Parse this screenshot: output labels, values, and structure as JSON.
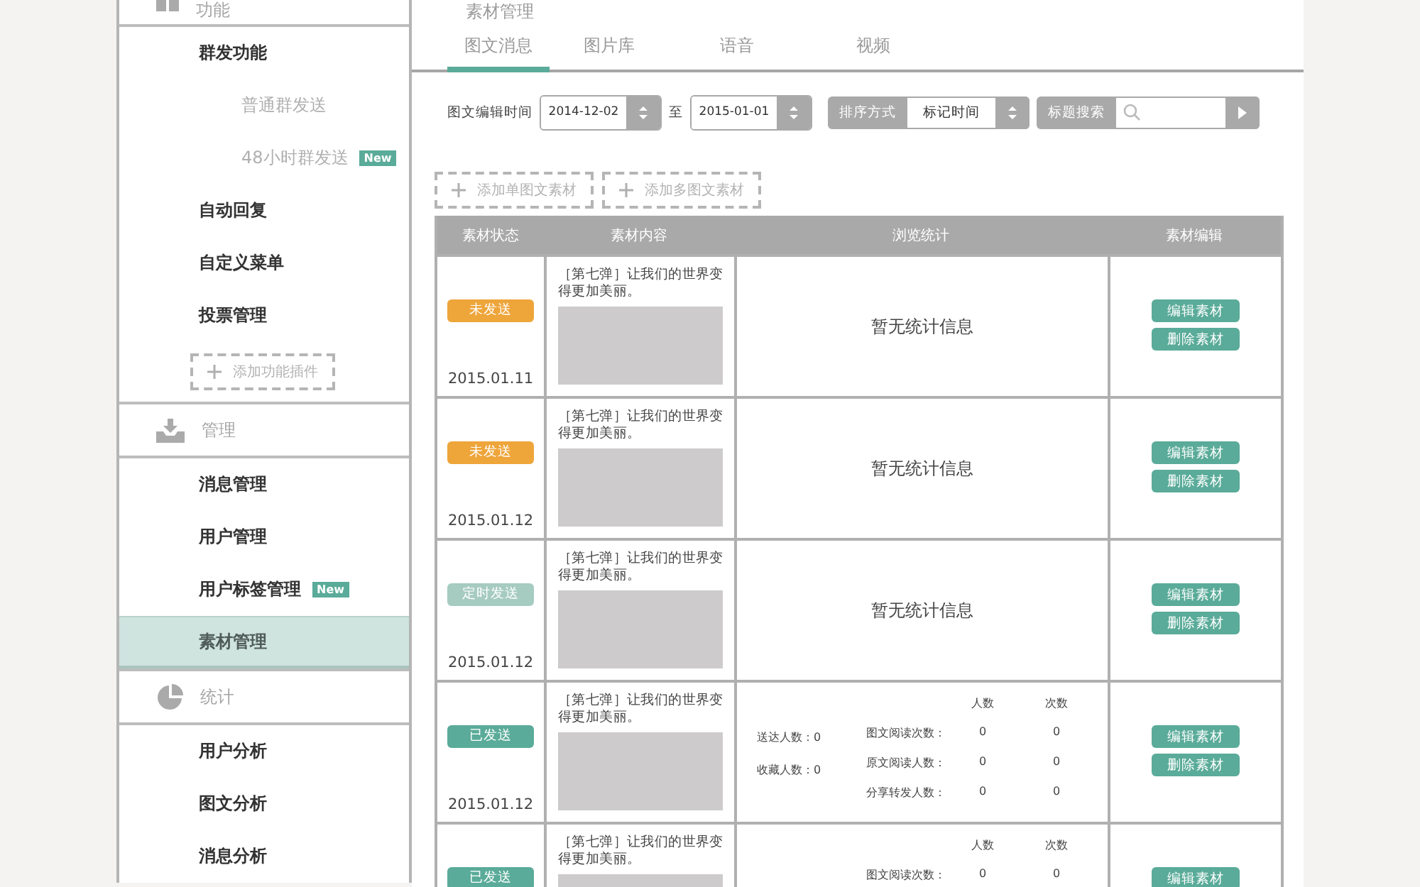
{
  "sidebar": {
    "sections": [
      {
        "title": "功能",
        "items": [
          {
            "label": "群发功能",
            "selected": false,
            "children": [
              {
                "label": "普通群发送",
                "selected": false
              },
              {
                "label": "48小时群发送",
                "badge": "New",
                "selected": false
              }
            ]
          },
          {
            "label": "自动回复",
            "selected": false
          },
          {
            "label": "自定义菜单",
            "selected": false
          },
          {
            "label": "投票管理",
            "selected": false
          }
        ],
        "add_button": "添加功能插件"
      },
      {
        "title": "管理",
        "items": [
          {
            "label": "消息管理",
            "selected": false
          },
          {
            "label": "用户管理",
            "selected": false
          },
          {
            "label": "用户标签管理",
            "badge": "New",
            "selected": false
          },
          {
            "label": "素材管理",
            "selected": true
          }
        ]
      },
      {
        "title": "统计",
        "items": [
          {
            "label": "用户分析",
            "selected": false
          },
          {
            "label": "图文分析",
            "selected": false
          },
          {
            "label": "消息分析",
            "selected": false
          }
        ]
      }
    ]
  },
  "main": {
    "breadcrumb": "素材管理",
    "tabs": [
      {
        "label": "图文消息",
        "selected": true
      },
      {
        "label": "图片库",
        "selected": false
      },
      {
        "label": "语音",
        "selected": false
      },
      {
        "label": "视频",
        "selected": false
      }
    ],
    "filters": {
      "date_label": "图文编辑时间",
      "from": "2014-12-02",
      "separator": "至",
      "to": "2015-01-01",
      "sort_label": "排序方式",
      "sort_value": "标记时间",
      "search_label": "标题搜索"
    },
    "add_buttons": [
      "添加单图文素材",
      "添加多图文素材"
    ],
    "table": {
      "columns": [
        "素材状态",
        "素材内容",
        "浏览统计",
        "素材编辑"
      ],
      "rows": [
        {
          "status": {
            "label": "未发送",
            "kind": "unsent"
          },
          "date": "2015.01.11",
          "title": "［第七弹］让我们的世界变得更加美丽。",
          "stats": {
            "kind": "empty",
            "text": "暂无统计信息"
          },
          "actions": [
            "编辑素材",
            "删除素材"
          ]
        },
        {
          "status": {
            "label": "未发送",
            "kind": "unsent"
          },
          "date": "2015.01.12",
          "title": "［第七弹］让我们的世界变得更加美丽。",
          "stats": {
            "kind": "empty",
            "text": "暂无统计信息"
          },
          "actions": [
            "编辑素材",
            "删除素材"
          ]
        },
        {
          "status": {
            "label": "定时发送",
            "kind": "scheduled"
          },
          "date": "2015.01.12",
          "title": "［第七弹］让我们的世界变得更加美丽。",
          "stats": {
            "kind": "empty",
            "text": "暂无统计信息"
          },
          "actions": [
            "编辑素材",
            "删除素材"
          ]
        },
        {
          "status": {
            "label": "已发送",
            "kind": "sent"
          },
          "date": "2015.01.12",
          "title": "［第七弹］让我们的世界变得更加美丽。",
          "stats": {
            "kind": "detail",
            "summary": [
              "送达人数：0",
              "收藏人数：0"
            ],
            "headers": [
              "人数",
              "次数"
            ],
            "lines": [
              {
                "label": "图文阅读次数：",
                "values": [
                  "0",
                  "0"
                ]
              },
              {
                "label": "原文阅读人数：",
                "values": [
                  "0",
                  "0"
                ]
              },
              {
                "label": "分享转发人数：",
                "values": [
                  "0",
                  "0"
                ]
              }
            ]
          },
          "actions": [
            "编辑素材",
            "删除素材"
          ]
        },
        {
          "status": {
            "label": "已发送",
            "kind": "sent"
          },
          "title": "［第七弹］让我们的世界变得更加美丽。",
          "stats": {
            "kind": "detail",
            "headers": [
              "人数",
              "次数"
            ],
            "lines": [
              {
                "label": "图文阅读次数：",
                "values": [
                  "0",
                  "0"
                ]
              }
            ]
          },
          "actions": [
            "编辑素材"
          ]
        }
      ]
    }
  }
}
